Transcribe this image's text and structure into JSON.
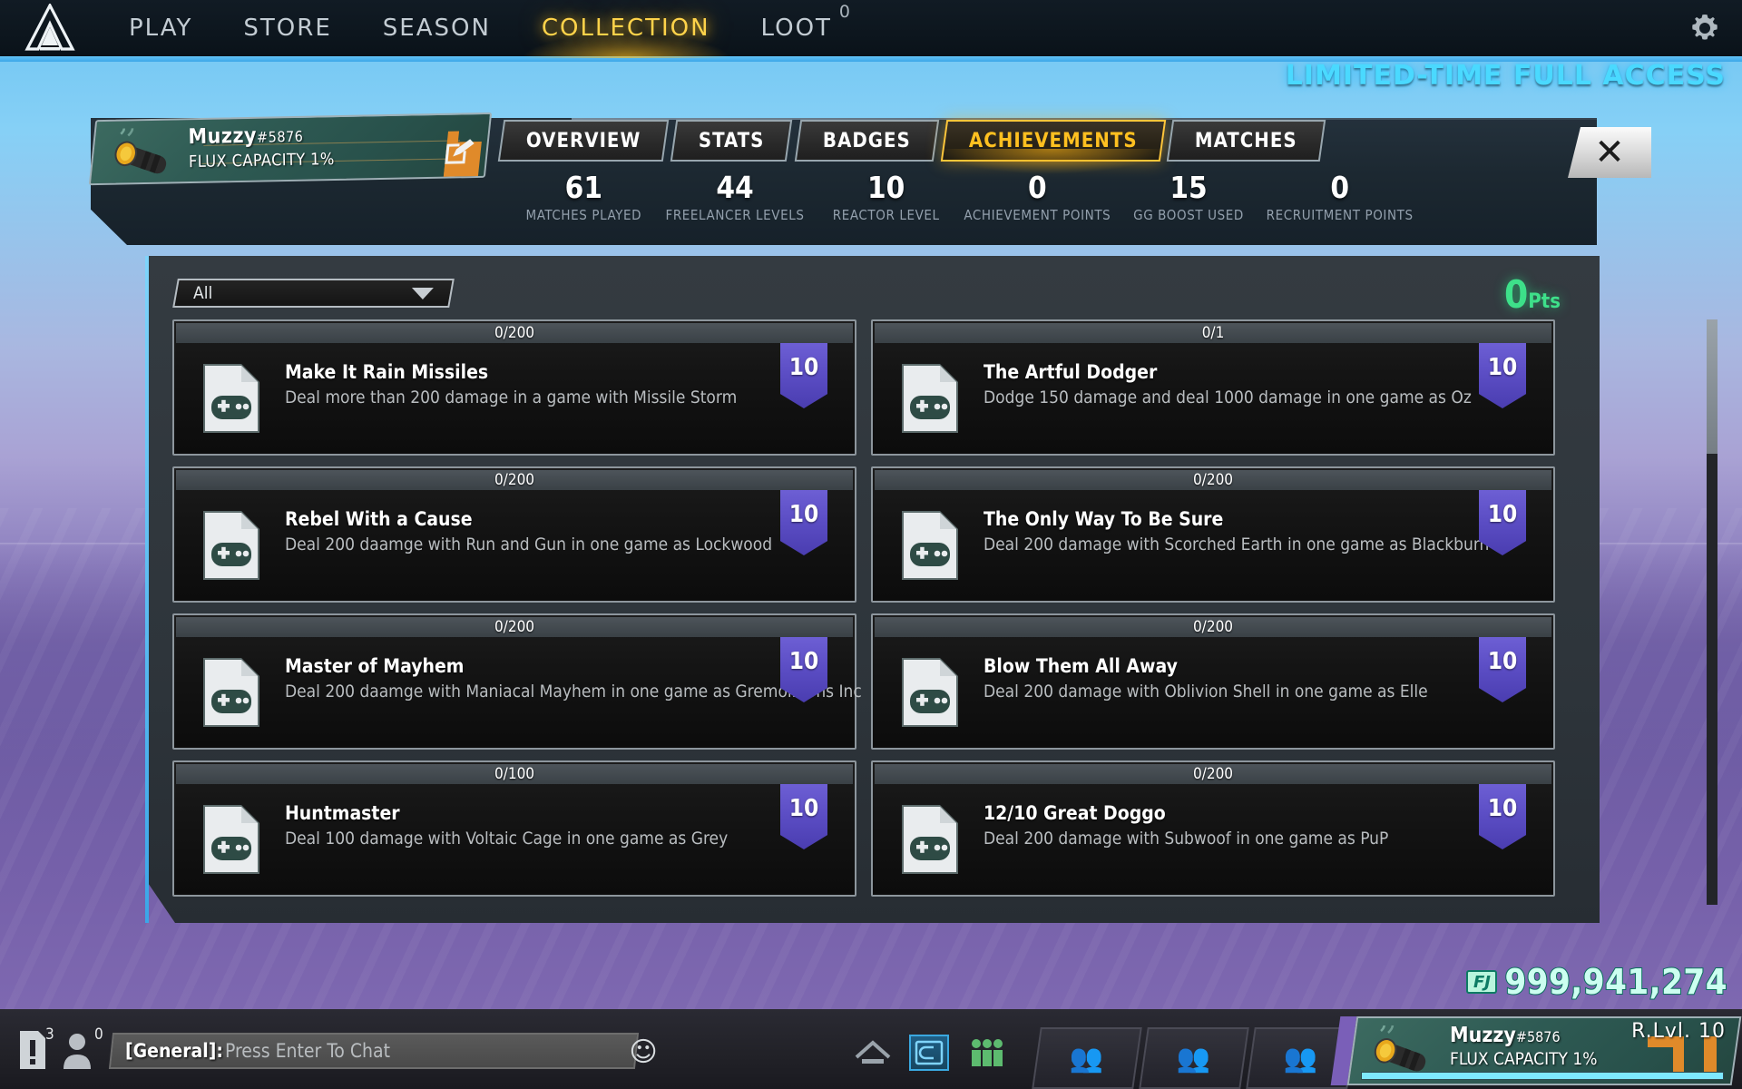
{
  "topnav": {
    "logo_name": "atlas-logo",
    "items": [
      {
        "label": "PLAY",
        "active": false,
        "badge": ""
      },
      {
        "label": "STORE",
        "active": false,
        "badge": ""
      },
      {
        "label": "SEASON",
        "active": false,
        "badge": ""
      },
      {
        "label": "COLLECTION",
        "active": true,
        "badge": ""
      },
      {
        "label": "LOOT",
        "active": false,
        "badge": "0"
      }
    ],
    "settings_icon": "gear-icon"
  },
  "banner": {
    "limited_access": "LIMITED-TIME FULL ACCESS"
  },
  "player": {
    "name": "Muzzy",
    "tag": "#5876",
    "title": "FLUX CAPACITY 1%",
    "edit_icon": "edit-pencil-icon"
  },
  "tabs": [
    {
      "label": "OVERVIEW",
      "active": false
    },
    {
      "label": "STATS",
      "active": false
    },
    {
      "label": "BADGES",
      "active": false
    },
    {
      "label": "ACHIEVEMENTS",
      "active": true
    },
    {
      "label": "MATCHES",
      "active": false
    }
  ],
  "close_button": "✕",
  "stats": [
    {
      "value": "61",
      "label": "MATCHES PLAYED"
    },
    {
      "value": "44",
      "label": "FREELANCER LEVELS"
    },
    {
      "value": "10",
      "label": "REACTOR LEVEL"
    },
    {
      "value": "0",
      "label": "ACHIEVEMENT POINTS"
    },
    {
      "value": "15",
      "label": "GG BOOST USED"
    },
    {
      "value": "0",
      "label": "RECRUITMENT POINTS"
    }
  ],
  "filter": {
    "selected": "All",
    "options": [
      "All"
    ]
  },
  "points": {
    "value": "0",
    "unit": "Pts"
  },
  "achievements": [
    {
      "progress": "0/200",
      "title": "Make It Rain Missiles",
      "description": "Deal more than 200 damage in a game with Missile Storm",
      "points": "10",
      "icon": "achievement-gamepad-icon"
    },
    {
      "progress": "0/1",
      "title": "The Artful Dodger",
      "description": "Dodge 150 damage and deal 1000 damage in one game as Oz",
      "points": "10",
      "icon": "achievement-gamepad-icon"
    },
    {
      "progress": "0/200",
      "title": "Rebel With a Cause",
      "description": "Deal 200 daamge with Run and Gun in one game as Lockwood",
      "points": "10",
      "icon": "achievement-gamepad-icon"
    },
    {
      "progress": "0/200",
      "title": "The Only Way To Be Sure",
      "description": "Deal 200 damage with Scorched Earth in one game as Blackburn",
      "points": "10",
      "icon": "achievement-gamepad-icon"
    },
    {
      "progress": "0/200",
      "title": "Master of Mayhem",
      "description": "Deal 200 daamge with Maniacal Mayhem in one game as Gremolitions Inc",
      "points": "10",
      "icon": "achievement-gamepad-icon"
    },
    {
      "progress": "0/200",
      "title": "Blow Them All Away",
      "description": "Deal 200 damage with Oblivion Shell in one game as Elle",
      "points": "10",
      "icon": "achievement-gamepad-icon"
    },
    {
      "progress": "0/100",
      "title": "Huntmaster",
      "description": "Deal 100 damage with Voltaic Cage in one game as Grey",
      "points": "10",
      "icon": "achievement-gamepad-icon"
    },
    {
      "progress": "0/200",
      "title": "12/10 Great Doggo",
      "description": "Deal 200 damage with Subwoof in one game as PuP",
      "points": "10",
      "icon": "achievement-gamepad-icon"
    }
  ],
  "currency": {
    "icon_label": "FJ",
    "amount": "999,941,274"
  },
  "bottom": {
    "alert_count": "3",
    "friend_count": "0",
    "chat_channel": "[General]:",
    "chat_placeholder": "Press Enter To Chat",
    "emoji_icon": "smiley-icon",
    "center_icons": [
      "home-icon",
      "card-icon",
      "roster-icon"
    ],
    "card_icon_label": "100000\n0000",
    "squad_slots": [
      "squad-slot-1",
      "squad-slot-2",
      "squad-slot-3"
    ],
    "player_name": "Muzzy",
    "player_tag": "#5876",
    "player_title": "FLUX CAPACITY 1%",
    "reactor_level": "R.Lvl. 10"
  },
  "colors": {
    "accent_yellow": "#ffc020",
    "accent_cyan": "#4ad9ff",
    "badge_purple": "#5c4ec5",
    "points_green": "#3ee08a",
    "currency_green": "#ccfff0"
  }
}
